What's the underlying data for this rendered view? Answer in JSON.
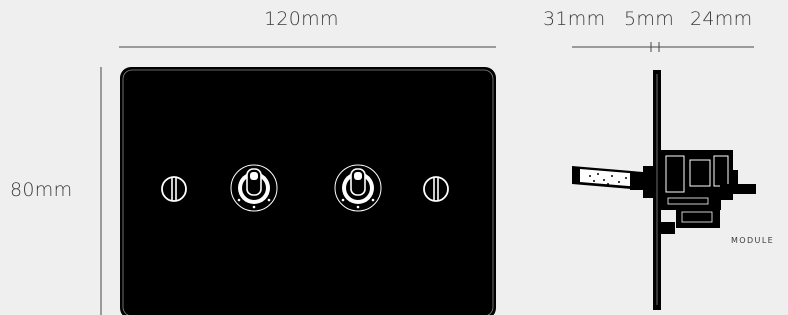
{
  "dimensions": {
    "width_label": "120mm",
    "height_label": "80mm",
    "depth_front_label": "31mm",
    "depth_plate_label": "5mm",
    "depth_back_label": "24mm"
  },
  "side_view": {
    "module_label": "MODULE"
  },
  "colors": {
    "background": "#efefef",
    "plate": "#000000",
    "line": "#333333",
    "switch_white": "#ffffff"
  },
  "front_plate": {
    "screw_count": 2,
    "toggle_count": 2
  }
}
